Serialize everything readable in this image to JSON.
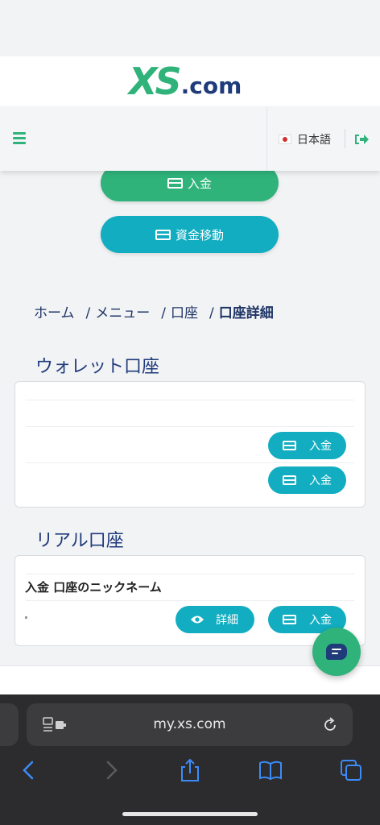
{
  "logo": {
    "mark": "XS",
    "suffix": ".com"
  },
  "nav": {
    "language": "日本語",
    "menu_icon": "hamburger-icon",
    "logout_icon": "logout-icon"
  },
  "actions": {
    "deposit_label": "入金",
    "transfer_label": "資金移動"
  },
  "breadcrumb": {
    "items": [
      "ホーム",
      "メニュー",
      "口座"
    ],
    "current": "口座詳細",
    "separator": "/"
  },
  "wallet_section": {
    "title": "ウォレット口座",
    "rows": [
      {
        "deposit_label": "入金"
      },
      {
        "deposit_label": "入金"
      }
    ]
  },
  "real_section": {
    "title": "リアル口座",
    "header_text": "入金  口座のニックネーム",
    "details_label": "詳細",
    "deposit_label": "入金"
  },
  "browser": {
    "url": "my.xs.com"
  },
  "colors": {
    "brand_green": "#2fb37a",
    "teal": "#12adc1",
    "navy": "#1f3b7a"
  }
}
